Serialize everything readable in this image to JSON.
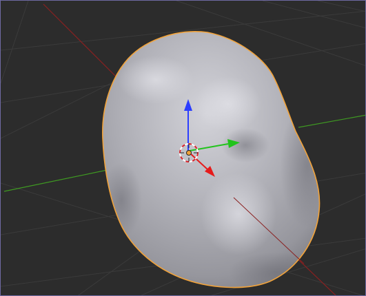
{
  "viewport": {
    "background": "#2c2c2c",
    "frame_color": "#6f6aa3",
    "grid_color": "#3b3b3b",
    "x_axis_color": "#8a2020",
    "y_axis_color": "#3f9a22"
  },
  "object": {
    "shape": "organic blob mesh",
    "shading_light": "#c9c9d0",
    "shading_dark": "#8d8d94",
    "selection_outline_color": "#f2a33a",
    "selected": true
  },
  "gizmo": {
    "z_arrow": "blue-arrow-icon",
    "y_arrow": "green-arrow-icon",
    "x_arrow": "red-arrow-icon",
    "z_color": "#2b3dff",
    "y_color": "#22c41c",
    "x_color": "#e61b1b",
    "pivot": "3d-cursor-icon"
  }
}
